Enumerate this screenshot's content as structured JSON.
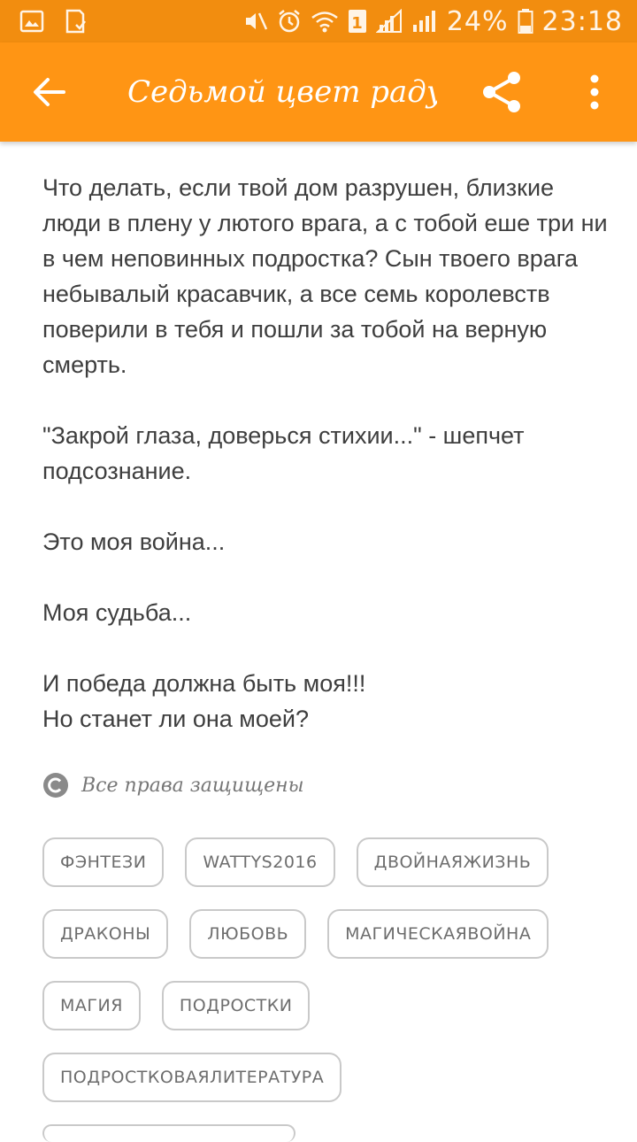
{
  "status_bar": {
    "battery": "24%",
    "time": "23:18",
    "sim_slot": "1",
    "icons": [
      "gallery-icon",
      "sd-card-icon",
      "mute-icon",
      "alarm-icon",
      "wifi-icon",
      "sim-icon",
      "signal-icon",
      "signal-icon",
      "battery-icon"
    ]
  },
  "app_bar": {
    "title": "Седьмой цвет раду...",
    "back_icon": "arrow-left-icon",
    "share_icon": "share-icon",
    "more_icon": "more-vert-icon",
    "background": "#ff9514"
  },
  "description": {
    "paragraphs": [
      "Что делать, если твой дом разрушен, близкие люди в плену у лютого врага, а с тобой еше три ни в чем неповинных подростка? Сын твоего врага небывалый красавчик, а все семь королевств поверили в тебя и пошли за тобой на верную смерть.",
      "\"Закрой глаза, доверься стихии...\" - шепчет подсознание.",
      "Это моя война...",
      "Моя судьба...",
      "И победа должна быть моя!!!",
      "Но станет ли она моей?"
    ]
  },
  "copyright": {
    "icon": "copyright-icon",
    "text": "Все права защищены"
  },
  "tags": [
    "ФЭНТЕЗИ",
    "WATTYS2016",
    "ДВОЙНАЯЖИЗНЬ",
    "ДРАКОНЫ",
    "ЛЮБОВЬ",
    "МАГИЧЕСКАЯВОЙНА",
    "МАГИЯ",
    "ПОДРОСТКИ",
    "ПОДРОСТКОВАЯЛИТЕРАТУРА"
  ]
}
